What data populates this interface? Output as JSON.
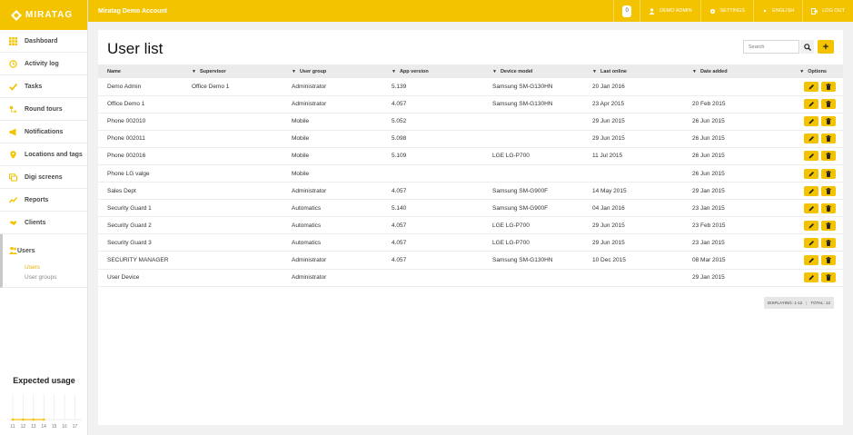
{
  "brand": {
    "logo_text": "MIRATAG",
    "accent": "#f3c300"
  },
  "topbar": {
    "title": "Miratag Demo Account",
    "notification_count": "0",
    "user": "DEMO ADMIN",
    "settings": "SETTINGS",
    "language": "ENGLISH",
    "logout": "LOG OUT"
  },
  "sidebar": {
    "items": [
      {
        "label": "Dashboard",
        "icon": "grid-icon"
      },
      {
        "label": "Activity log",
        "icon": "history-icon"
      },
      {
        "label": "Tasks",
        "icon": "check-icon"
      },
      {
        "label": "Round tours",
        "icon": "route-icon"
      },
      {
        "label": "Notifications",
        "icon": "megaphone-icon"
      },
      {
        "label": "Locations and tags",
        "icon": "location-pin-icon"
      },
      {
        "label": "Digi screens",
        "icon": "screens-icon"
      },
      {
        "label": "Reports",
        "icon": "chart-line-icon"
      },
      {
        "label": "Clients",
        "icon": "handshake-icon"
      }
    ],
    "users": {
      "label": "Users",
      "sub": [
        "Users",
        "User groups"
      ]
    },
    "usage": {
      "title": "Expected usage",
      "x_labels": [
        "11",
        "12",
        "13",
        "14",
        "15",
        "16",
        "17"
      ]
    }
  },
  "main": {
    "title": "User list",
    "search_placeholder": "Search",
    "add_label": "+",
    "columns": [
      "Name",
      "Supervisor",
      "User group",
      "App version",
      "Device model",
      "Last online",
      "Date added",
      "Options"
    ],
    "rows": [
      [
        "Demo Admin",
        "Office Demo 1",
        "Administrator",
        "5.139",
        "Samsung SM-G130HN",
        "20 Jan 2016",
        ""
      ],
      [
        "Office Demo 1",
        "",
        "Administrator",
        "4.057",
        "Samsung SM-G130HN",
        "23 Apr 2015",
        "20 Feb 2015"
      ],
      [
        "Phone 002010",
        "",
        "Mobile",
        "5.052",
        "",
        "29 Jun 2015",
        "26 Jun 2015"
      ],
      [
        "Phone 002011",
        "",
        "Mobile",
        "5.098",
        "",
        "29 Jun 2015",
        "26 Jun 2015"
      ],
      [
        "Phone 002016",
        "",
        "Mobile",
        "5.109",
        "LGE LG-P700",
        "11 Jul 2015",
        "26 Jun 2015"
      ],
      [
        "Phone LG valge",
        "",
        "Mobile",
        "",
        "",
        "",
        "26 Jun 2015"
      ],
      [
        "Sales Dept",
        "",
        "Administrator",
        "4.057",
        "Samsung SM-G900F",
        "14 May 2015",
        "29 Jan 2015"
      ],
      [
        "Security Guard 1",
        "",
        "Automatics",
        "5.140",
        "Samsung SM-G900F",
        "04 Jan 2016",
        "23 Jan 2015"
      ],
      [
        "Security Guard 2",
        "",
        "Automatics",
        "4.057",
        "LGE LG-P700",
        "29 Jun 2015",
        "23 Feb 2015"
      ],
      [
        "Security Guard 3",
        "",
        "Automatics",
        "4.057",
        "LGE LG-P700",
        "29 Jun 2015",
        "23 Jan 2015"
      ],
      [
        "SECURITY MANAGER",
        "",
        "Administrator",
        "4.057",
        "Samsung SM-G130HN",
        "10 Dec 2015",
        "08 Mar 2015"
      ],
      [
        "User Device",
        "",
        "Administrator",
        "",
        "",
        "",
        "29 Jan 2015"
      ]
    ],
    "displaying": "DISPLAYING: 1-12",
    "total": "TOTAL: 12"
  }
}
